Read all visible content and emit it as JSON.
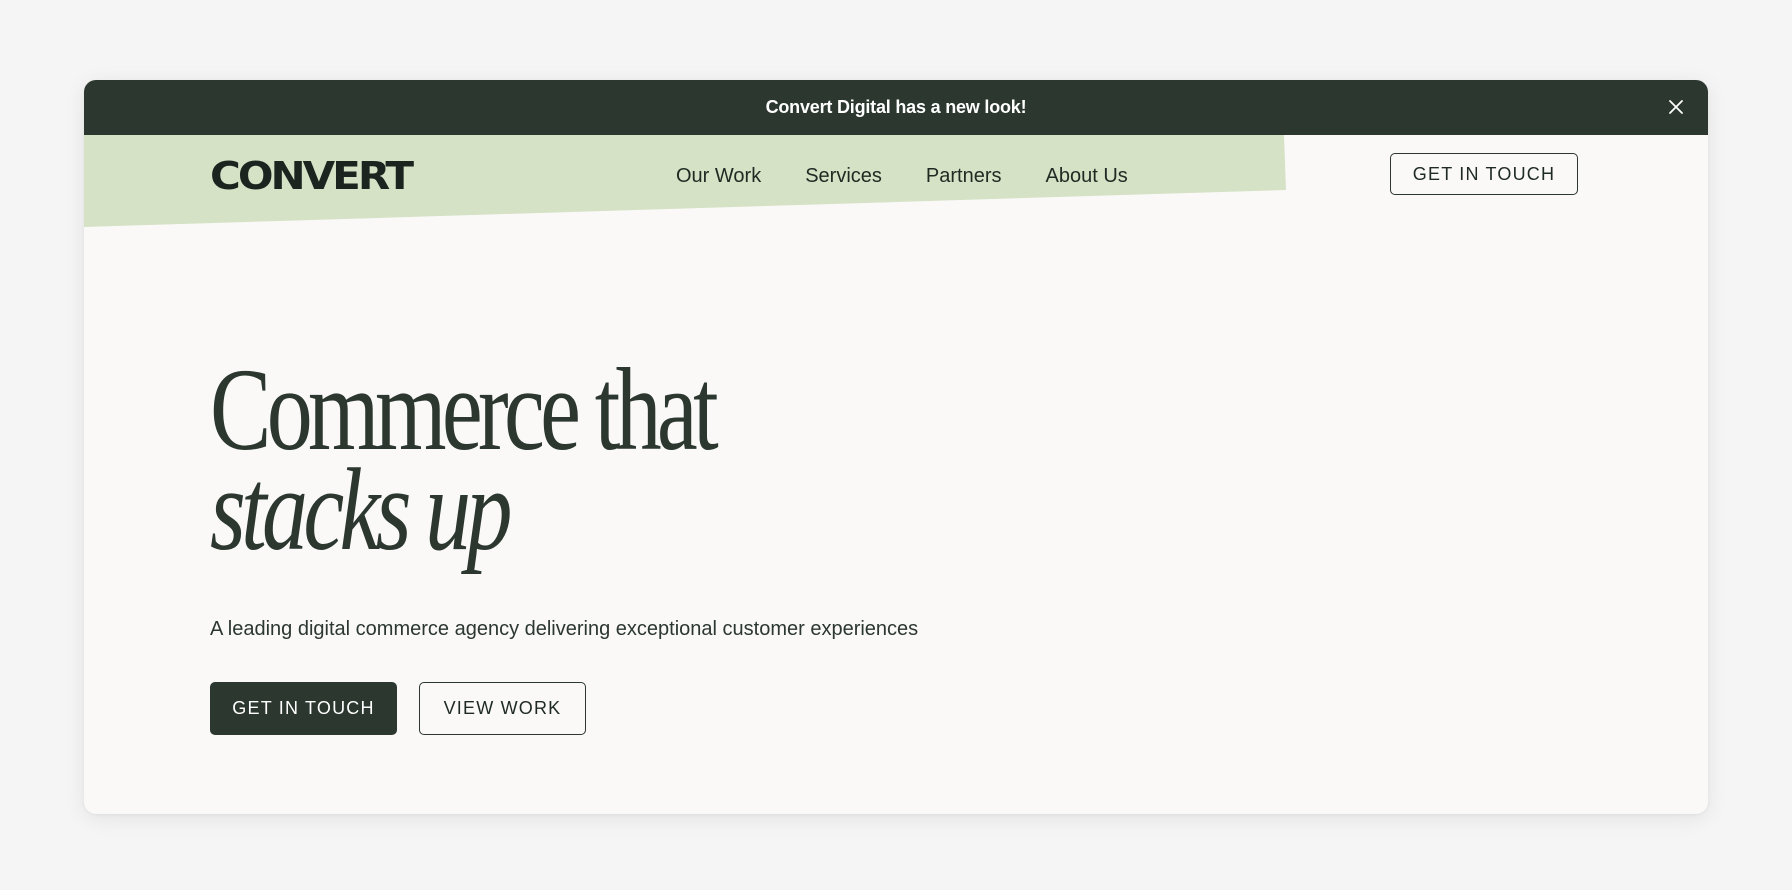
{
  "announcement": {
    "text": "Convert Digital has a new look!",
    "close_icon": "close-icon"
  },
  "header": {
    "logo": "CONVERT",
    "nav": [
      {
        "label": "Our Work"
      },
      {
        "label": "Services"
      },
      {
        "label": "Partners"
      },
      {
        "label": "About Us"
      }
    ],
    "cta_label": "GET IN TOUCH"
  },
  "hero": {
    "title_line1": "Commerce that",
    "title_line2": "stacks up",
    "subtitle": "A leading digital commerce agency delivering exceptional customer experiences",
    "primary_cta": "GET IN TOUCH",
    "secondary_cta": "VIEW WORK"
  },
  "colors": {
    "dark_green": "#2b372f",
    "sage": "#d5e2c5",
    "page_bg": "#faf9f8",
    "outer_bg": "#f5f5f5"
  }
}
